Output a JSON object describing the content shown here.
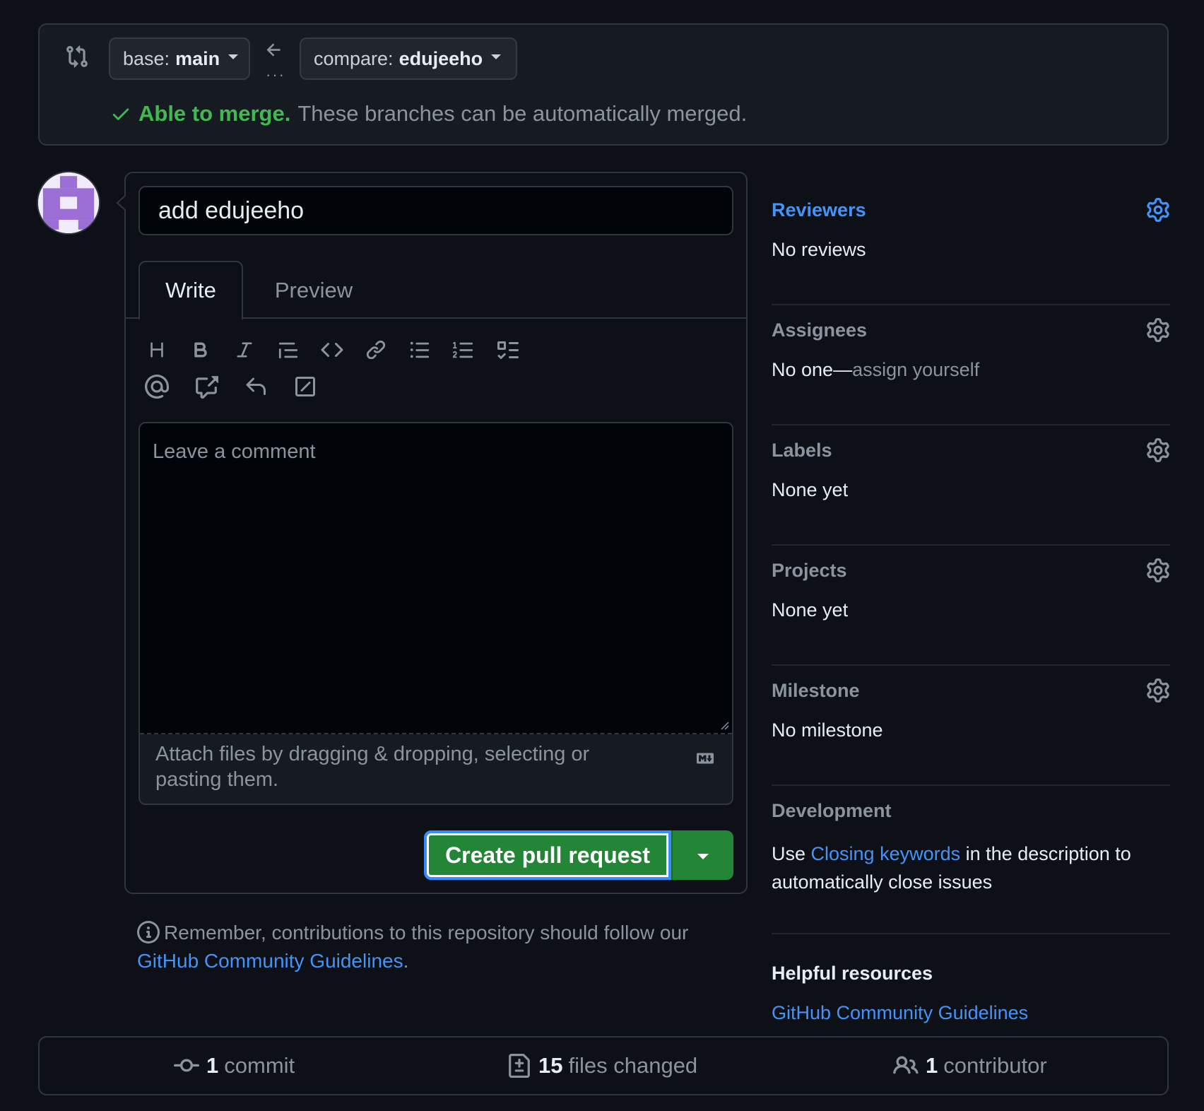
{
  "compare": {
    "base_label": "base:",
    "base_value": "main",
    "compare_label": "compare:",
    "compare_value": "edujeeho",
    "merge_status": "Able to merge.",
    "merge_message": "These branches can be automatically merged."
  },
  "form": {
    "title_value": "add edujeeho",
    "tabs": [
      {
        "label": "Write",
        "selected": true
      },
      {
        "label": "Preview",
        "selected": false
      }
    ],
    "toolbar_icons": [
      "heading-icon",
      "bold-icon",
      "italic-icon",
      "quote-icon",
      "code-icon",
      "link-icon",
      "bulleted-list-icon",
      "numbered-list-icon",
      "task-list-icon",
      "mention-icon",
      "cross-reference-icon",
      "saved-reply-icon",
      "slash-command-icon"
    ],
    "comment_placeholder": "Leave a comment",
    "attach_text": "Attach files by dragging & dropping, selecting or pasting them.",
    "submit_label": "Create pull request"
  },
  "remember": {
    "text": "Remember, contributions to this repository should follow our",
    "link": "GitHub Community Guidelines",
    "suffix": "."
  },
  "sidebar": {
    "reviewers": {
      "title": "Reviewers",
      "value": "No reviews"
    },
    "assignees": {
      "title": "Assignees",
      "value_prefix": "No one—",
      "value_link": "assign yourself"
    },
    "labels": {
      "title": "Labels",
      "value": "None yet"
    },
    "projects": {
      "title": "Projects",
      "value": "None yet"
    },
    "milestone": {
      "title": "Milestone",
      "value": "No milestone"
    },
    "development": {
      "title": "Development",
      "prefix": "Use",
      "link": "Closing keywords",
      "suffix": "in the description to automatically close issues"
    },
    "helpful": {
      "title": "Helpful resources",
      "link": "GitHub Community Guidelines"
    }
  },
  "stats": {
    "commits_count": "1",
    "commits_label": "commit",
    "files_count": "15",
    "files_label": "files changed",
    "contributors_count": "1",
    "contributors_label": "contributor"
  },
  "colors": {
    "background": "#0d1117",
    "success": "#3fb950",
    "link": "#4493f8",
    "primary_button": "#238636",
    "muted_text": "#8b949e"
  }
}
